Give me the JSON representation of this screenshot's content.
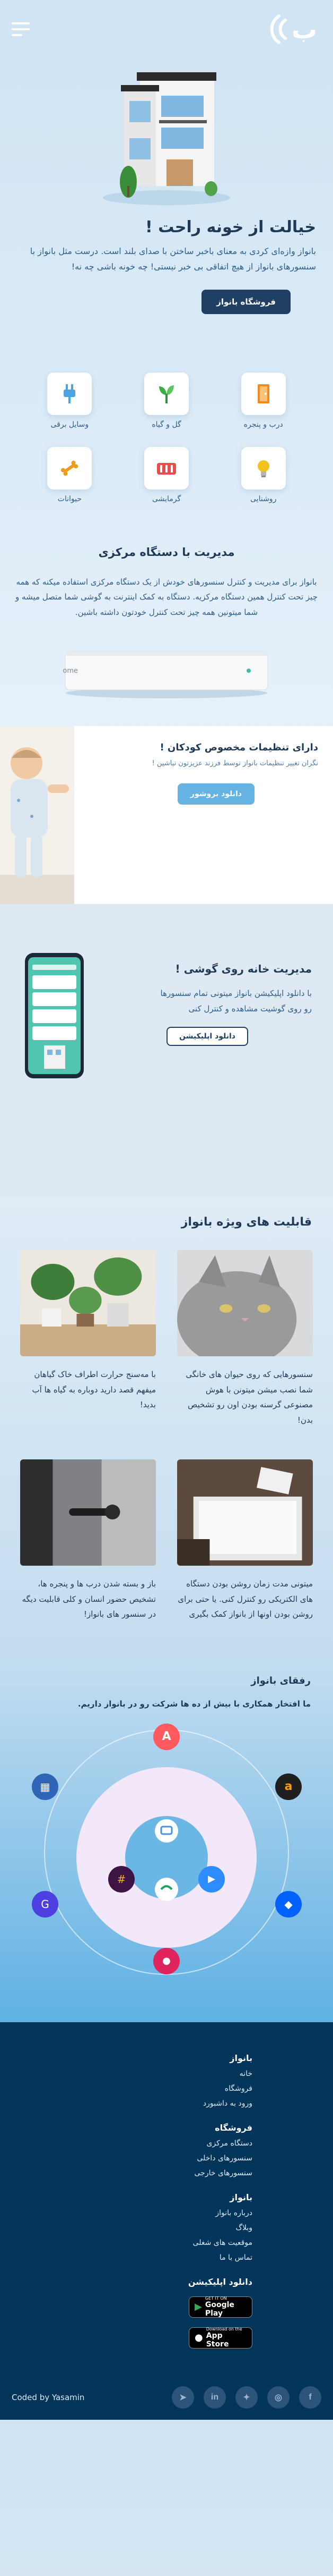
{
  "header": {
    "logo_text": "ب"
  },
  "hero": {
    "title": "خیالت از خونه راحت !",
    "text": "بانواز وازه‌ای کردی به معنای باخبر ساختن با صدای بلند است. درست مثل بانواز با سنسورهای بانواز از هیچ اتفاقی بی خبر نیستی! چه خونه باشی چه نه!",
    "cta": "فروشگاه بانواز"
  },
  "categories": [
    {
      "label": "درب و پنجره",
      "icon": "door-icon",
      "color": "#f28a1c"
    },
    {
      "label": "گل و گیاه",
      "icon": "plant-icon",
      "color": "#3fae49"
    },
    {
      "label": "وسایل برقی",
      "icon": "plug-icon",
      "color": "#4da3df"
    },
    {
      "label": "روشنایی",
      "icon": "lamp-icon",
      "color": "#f2c21c"
    },
    {
      "label": "گرمایشی",
      "icon": "heater-icon",
      "color": "#e84e4e"
    },
    {
      "label": "حیوانات",
      "icon": "bone-icon",
      "color": "#f29a1c"
    }
  ],
  "central": {
    "title": "مدیریت با دستگاه مرکزی",
    "text": "بانواز برای مدیریت و کنترل سنسورهای خودش از یک دستگاه مرکزی استفاده میکنه که همه چیز تحت کنترل همین دستگاه مرکزیه. دستگاه به کمک اینترنت به گوشی شما متصل میشه و شما میتونین همه چیز تحت کنترل خودتون داشته باشین.",
    "device_label": "Bano Home"
  },
  "kids": {
    "title": "دارای تنظیمات مخصوص کودکان !",
    "subtitle": "نگران تغییر تنظیمات بانواز توسط فرزند عزیزتون نباشین !",
    "button": "دانلود بروشور"
  },
  "mobile": {
    "title": "مدیریت خانه روی گوشی !",
    "text": "با دانلود اپلیکیشن بانواز میتونی تمام سنسورها رو روی گوشیت مشاهده و کنترل کنی",
    "button": "دانلود اپلیکیشن"
  },
  "features": {
    "title": "قابلیت های ویژه بانواز",
    "items": [
      {
        "text": "سنسورهایی که روی حیوان های خانگی شما نصب میشن میتونن با هوش مصنوعی گرسنه بودن اون رو تشخیص بدن!"
      },
      {
        "text": "با مه‌سنج حرارت اطراف خاک گیاهان میفهم قصد دارید دوباره به گیاه ها آب بدید!"
      },
      {
        "text": "میتونی مدت زمان روشن بودن دستگاه های الکتریکی رو کنترل کنی. یا حتی برای روشن بودن اونها از بانواز کمک بگیری"
      },
      {
        "text": "باز و بسته شدن درب ها و پنجره ها، تشخیص حضور انسان و کلی قابلیت دیگه در سنسور های بانواز!"
      }
    ]
  },
  "partners": {
    "title": "رفقای بانواز",
    "subtitle": "ما افتخار همکاری با بیش از ده ها شرکت رو در بانواز داریم."
  },
  "footer": {
    "columns": [
      {
        "title": "بانواز",
        "links": [
          "خانه",
          "فروشگاه",
          "ورود به داشبورد"
        ]
      },
      {
        "title": "فروشگاه",
        "links": [
          "دستگاه مرکزی",
          "سنسورهای داخلی",
          "سنسورهای خارجی"
        ]
      },
      {
        "title": "بانواز",
        "links": [
          "درباره بانواز",
          "وبلاگ",
          "موقعیت های شغلی",
          "تماس با ما"
        ]
      }
    ],
    "apps_title": "دانلود اپلیکیشن",
    "google_small": "GET IT ON",
    "google_big": "Google Play",
    "apple_small": "Download on the",
    "apple_big": "App Store",
    "coded_by": "Coded by Yasamin"
  },
  "colors": {
    "primary": "#1f3f63",
    "accent": "#66b3e3",
    "footer_bg": "#03345a"
  }
}
